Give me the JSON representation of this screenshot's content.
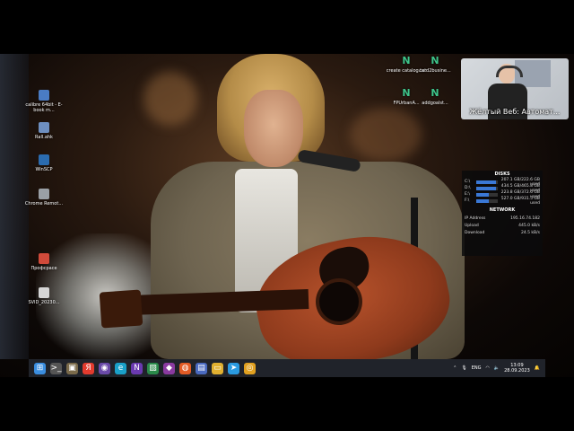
{
  "desktop_icons": [
    {
      "label": "calibre 64bit - E-book m...",
      "icon": "calibre-icon",
      "color": "#4a7cc4"
    },
    {
      "label": "Rall.ahk",
      "icon": "autohotkey-script-icon",
      "color": "#6e8fc0"
    },
    {
      "label": "WinSCP",
      "icon": "winscp-icon",
      "color": "#2b6cb0"
    },
    {
      "label": "Chrome Remot...",
      "icon": "chrome-remote-icon",
      "color": "#9aa0a6"
    },
    {
      "label": "Профсрасе",
      "icon": "app-icon",
      "color": "#d04a3a"
    },
    {
      "label": "SVID_20230...",
      "icon": "video-file-icon",
      "color": "#d6d6d6"
    }
  ],
  "desktop_icons_right": [
    {
      "label": "create catalog.txt",
      "icon": "notepad-n-icon"
    },
    {
      "label": "card2busine...",
      "icon": "notepad-n-icon"
    },
    {
      "label": "FPUrbanA...",
      "icon": "notepad-n-icon"
    },
    {
      "label": "addgoalst...",
      "icon": "notepad-n-icon"
    }
  ],
  "webcam": {
    "caption": "Жёлтый Веб: Автомат..."
  },
  "widget": {
    "disks_title": "DISKS",
    "disks": [
      {
        "name": "C:\\",
        "value": "207.1 GB/222.6 GB used",
        "fraction": 0.93
      },
      {
        "name": "D:\\",
        "value": "434.5 GB/465.8 GB used",
        "fraction": 0.93
      },
      {
        "name": "E:\\",
        "value": "223.8 GB/372.6 GB used",
        "fraction": 0.6
      },
      {
        "name": "F:\\",
        "value": "527.0 GB/931.5 GB used",
        "fraction": 0.57
      }
    ],
    "network_title": "NETWORK",
    "network": [
      {
        "label": "IP Address",
        "value": "195.16.74.182"
      },
      {
        "label": "Upload",
        "value": "445.0 kB/s"
      },
      {
        "label": "Download",
        "value": "24.5 kB/s"
      }
    ],
    "accent_color": "#3a78d6"
  },
  "taskbar": {
    "icons": [
      {
        "name": "start-icon",
        "glyph": "⊞",
        "color": "#3b8ee0"
      },
      {
        "name": "terminal-icon",
        "glyph": ">_",
        "color": "#555"
      },
      {
        "name": "app-icon",
        "glyph": "▣",
        "color": "#7a6a4a"
      },
      {
        "name": "yandex-icon",
        "glyph": "Я",
        "color": "#e23b2e"
      },
      {
        "name": "obs-icon",
        "glyph": "◉",
        "color": "#6a4aa8"
      },
      {
        "name": "edge-icon",
        "glyph": "e",
        "color": "#1aa0c8"
      },
      {
        "name": "onenote-icon",
        "glyph": "N",
        "color": "#6a3ab0"
      },
      {
        "name": "gallery-icon",
        "glyph": "▧",
        "color": "#2a8a4a"
      },
      {
        "name": "app2-icon",
        "glyph": "◆",
        "color": "#8a3aa0"
      },
      {
        "name": "brave-icon",
        "glyph": "◍",
        "color": "#e25b25"
      },
      {
        "name": "save-icon",
        "glyph": "▤",
        "color": "#4a6ac0"
      },
      {
        "name": "folder-icon",
        "glyph": "▭",
        "color": "#e0b030"
      },
      {
        "name": "telegram-icon",
        "glyph": "➤",
        "color": "#2a9ae0"
      },
      {
        "name": "chrome-icon",
        "glyph": "◎",
        "color": "#e0a020"
      }
    ],
    "language": "ENG",
    "time": "13:09",
    "date": "28.09.2023"
  }
}
